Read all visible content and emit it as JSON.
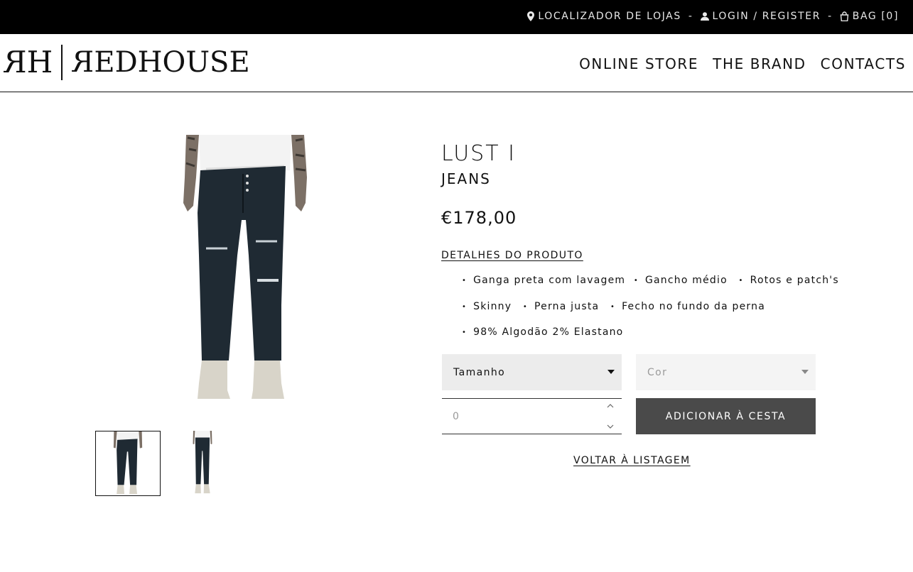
{
  "topbar": {
    "store_locator": "LOCALIZADOR DE LOJAS",
    "login": "LOGIN / REGISTER",
    "bag": "BAG [0]",
    "separator": "-"
  },
  "brand": {
    "monogram_left": "R",
    "monogram_right": "H",
    "word_first": "R",
    "word_rest": "EDHOUSE"
  },
  "nav": {
    "items": [
      "ONLINE STORE",
      "THE BRAND",
      "CONTACTS"
    ]
  },
  "product": {
    "title": "LUST I",
    "subtitle": "JEANS",
    "price": "€178,00",
    "details_label": "DETALHES DO PRODUTO",
    "features_row1": [
      "Ganga preta com lavagem",
      "Gancho médio",
      "Rotos e patch's"
    ],
    "features_row2": [
      "Skinny",
      "Perna justa",
      "Fecho no fundo da perna"
    ],
    "features_row3": [
      "98% Algodão 2% Elastano"
    ]
  },
  "form": {
    "size_placeholder": "Tamanho",
    "color_placeholder": "Cor",
    "quantity_value": "0",
    "add_button": "ADICIONAR À CESTA",
    "back_link": "VOLTAR À LISTAGEM"
  },
  "colors": {
    "topbar_bg": "#000000",
    "button_bg": "#4a4a4a",
    "select_bg": "#ececec"
  },
  "icons": {
    "store_locator": "map-pin-icon",
    "login": "user-icon",
    "bag": "shopping-bag-icon"
  }
}
